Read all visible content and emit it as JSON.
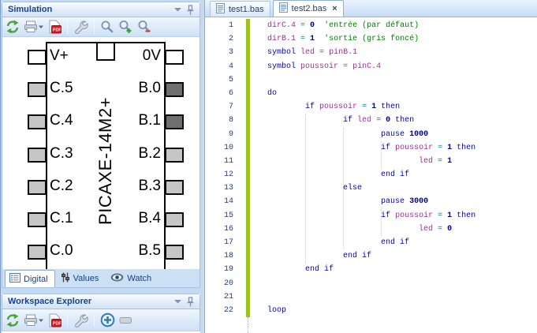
{
  "window": {
    "background": "#C5DAF1"
  },
  "simulation_panel": {
    "title": "Simulation",
    "titlebar_icons": [
      "chevron-down-icon",
      "pin-icon"
    ],
    "toolbar_icons": [
      "refresh-icon",
      "print-icon",
      "pdf-export-icon",
      "options-wrench-icon",
      "zoom-icon",
      "zoom-in-icon",
      "zoom-out-icon"
    ],
    "chip": {
      "label": "PICAXE-14M2+",
      "pin_colors": {
        "input": "#C6C6C6",
        "output_high": "#6F6F6F",
        "power": "#FFFFFF"
      },
      "left_pins": [
        {
          "label": "V+",
          "fill": "#FFFFFF"
        },
        {
          "label": "C.5",
          "fill": "#C6C6C6"
        },
        {
          "label": "C.4",
          "fill": "#C6C6C6"
        },
        {
          "label": "C.3",
          "fill": "#C6C6C6"
        },
        {
          "label": "C.2",
          "fill": "#C6C6C6"
        },
        {
          "label": "C.1",
          "fill": "#C6C6C6"
        },
        {
          "label": "C.0",
          "fill": "#C6C6C6"
        }
      ],
      "right_pins": [
        {
          "label": "0V",
          "fill": "#FFFFFF"
        },
        {
          "label": "B.0",
          "fill": "#6F6F6F"
        },
        {
          "label": "B.1",
          "fill": "#6F6F6F"
        },
        {
          "label": "B.2",
          "fill": "#C6C6C6"
        },
        {
          "label": "B.3",
          "fill": "#C6C6C6"
        },
        {
          "label": "B.4",
          "fill": "#C6C6C6"
        },
        {
          "label": "B.5",
          "fill": "#C6C6C6"
        }
      ]
    },
    "tabs": [
      {
        "label": "Digital",
        "icon": "digital-list-icon",
        "active": true
      },
      {
        "label": "Values",
        "icon": "values-sliders-icon",
        "active": false
      },
      {
        "label": "Watch",
        "icon": "watch-eye-icon",
        "active": false
      }
    ]
  },
  "workspace_panel": {
    "title": "Workspace Explorer",
    "titlebar_icons": [
      "chevron-down-icon",
      "pin-icon"
    ],
    "toolbar_icons": [
      "refresh-icon",
      "print-icon",
      "pdf-export-icon",
      "options-wrench-icon",
      "add-icon",
      "collapse-icon"
    ]
  },
  "editor": {
    "tabs": [
      {
        "label": "test1.bas",
        "icon": "file-icon",
        "active": false
      },
      {
        "label": "test2.bas",
        "icon": "file-icon",
        "active": true,
        "close_label": "×"
      }
    ],
    "change_bar_color": "#9CC31C",
    "syntax_colors": {
      "keyword": "#0000CD",
      "variable": "#993399",
      "number": "#000080",
      "operator": "#008080",
      "comment": "#008000",
      "line_number": "#1F3A93"
    },
    "lines": [
      {
        "n": 1,
        "indent": 0,
        "tokens": [
          [
            "v",
            "dirC.4"
          ],
          [
            "o",
            " = "
          ],
          [
            "n",
            "0"
          ],
          [
            "p",
            "  "
          ],
          [
            "c",
            "'entrée (par défaut)"
          ]
        ]
      },
      {
        "n": 2,
        "indent": 0,
        "tokens": [
          [
            "v",
            "dirB.1"
          ],
          [
            "o",
            " = "
          ],
          [
            "n",
            "1"
          ],
          [
            "p",
            "  "
          ],
          [
            "c",
            "'sortie (gris foncé)"
          ]
        ]
      },
      {
        "n": 3,
        "indent": 0,
        "tokens": [
          [
            "k",
            "symbol"
          ],
          [
            "p",
            " "
          ],
          [
            "v",
            "led"
          ],
          [
            "o",
            " = "
          ],
          [
            "v",
            "pinB.1"
          ]
        ]
      },
      {
        "n": 4,
        "indent": 0,
        "tokens": [
          [
            "k",
            "symbol"
          ],
          [
            "p",
            " "
          ],
          [
            "v",
            "poussoir"
          ],
          [
            "o",
            " = "
          ],
          [
            "v",
            "pinC.4"
          ]
        ]
      },
      {
        "n": 5,
        "indent": 0,
        "tokens": []
      },
      {
        "n": 6,
        "indent": 0,
        "tokens": [
          [
            "k",
            "do"
          ]
        ]
      },
      {
        "n": 7,
        "indent": 8,
        "tokens": [
          [
            "k",
            "if"
          ],
          [
            "p",
            " "
          ],
          [
            "v",
            "poussoir"
          ],
          [
            "o",
            " = "
          ],
          [
            "n",
            "1"
          ],
          [
            "p",
            " "
          ],
          [
            "k",
            "then"
          ]
        ]
      },
      {
        "n": 8,
        "indent": 16,
        "tokens": [
          [
            "k",
            "if"
          ],
          [
            "p",
            " "
          ],
          [
            "v",
            "led"
          ],
          [
            "o",
            " = "
          ],
          [
            "n",
            "0"
          ],
          [
            "p",
            " "
          ],
          [
            "k",
            "then"
          ]
        ]
      },
      {
        "n": 9,
        "indent": 24,
        "tokens": [
          [
            "k",
            "pause"
          ],
          [
            "p",
            " "
          ],
          [
            "n",
            "1000"
          ]
        ]
      },
      {
        "n": 10,
        "indent": 24,
        "tokens": [
          [
            "k",
            "if"
          ],
          [
            "p",
            " "
          ],
          [
            "v",
            "poussoir"
          ],
          [
            "o",
            " = "
          ],
          [
            "n",
            "1"
          ],
          [
            "p",
            " "
          ],
          [
            "k",
            "then"
          ]
        ]
      },
      {
        "n": 11,
        "indent": 32,
        "tokens": [
          [
            "v",
            "led"
          ],
          [
            "o",
            " = "
          ],
          [
            "n",
            "1"
          ]
        ]
      },
      {
        "n": 12,
        "indent": 24,
        "tokens": [
          [
            "k",
            "end if"
          ]
        ]
      },
      {
        "n": 13,
        "indent": 16,
        "tokens": [
          [
            "k",
            "else"
          ]
        ]
      },
      {
        "n": 14,
        "indent": 24,
        "tokens": [
          [
            "k",
            "pause"
          ],
          [
            "p",
            " "
          ],
          [
            "n",
            "3000"
          ]
        ]
      },
      {
        "n": 15,
        "indent": 24,
        "tokens": [
          [
            "k",
            "if"
          ],
          [
            "p",
            " "
          ],
          [
            "v",
            "poussoir"
          ],
          [
            "o",
            " = "
          ],
          [
            "n",
            "1"
          ],
          [
            "p",
            " "
          ],
          [
            "k",
            "then"
          ]
        ]
      },
      {
        "n": 16,
        "indent": 32,
        "tokens": [
          [
            "v",
            "led"
          ],
          [
            "o",
            " = "
          ],
          [
            "n",
            "0"
          ]
        ]
      },
      {
        "n": 17,
        "indent": 24,
        "tokens": [
          [
            "k",
            "end if"
          ]
        ]
      },
      {
        "n": 18,
        "indent": 16,
        "tokens": [
          [
            "k",
            "end if"
          ]
        ]
      },
      {
        "n": 19,
        "indent": 8,
        "tokens": [
          [
            "k",
            "end if"
          ]
        ]
      },
      {
        "n": 20,
        "indent": 0,
        "tokens": []
      },
      {
        "n": 21,
        "indent": 0,
        "tokens": []
      },
      {
        "n": 22,
        "indent": 0,
        "tokens": [
          [
            "k",
            "loop"
          ]
        ]
      }
    ],
    "indent_guides": [
      {
        "col": 8,
        "from": 8,
        "to": 19
      },
      {
        "col": 16,
        "from": 9,
        "to": 18
      },
      {
        "col": 24,
        "from": 10,
        "to": 12
      },
      {
        "col": 24,
        "from": 15,
        "to": 17
      }
    ]
  }
}
